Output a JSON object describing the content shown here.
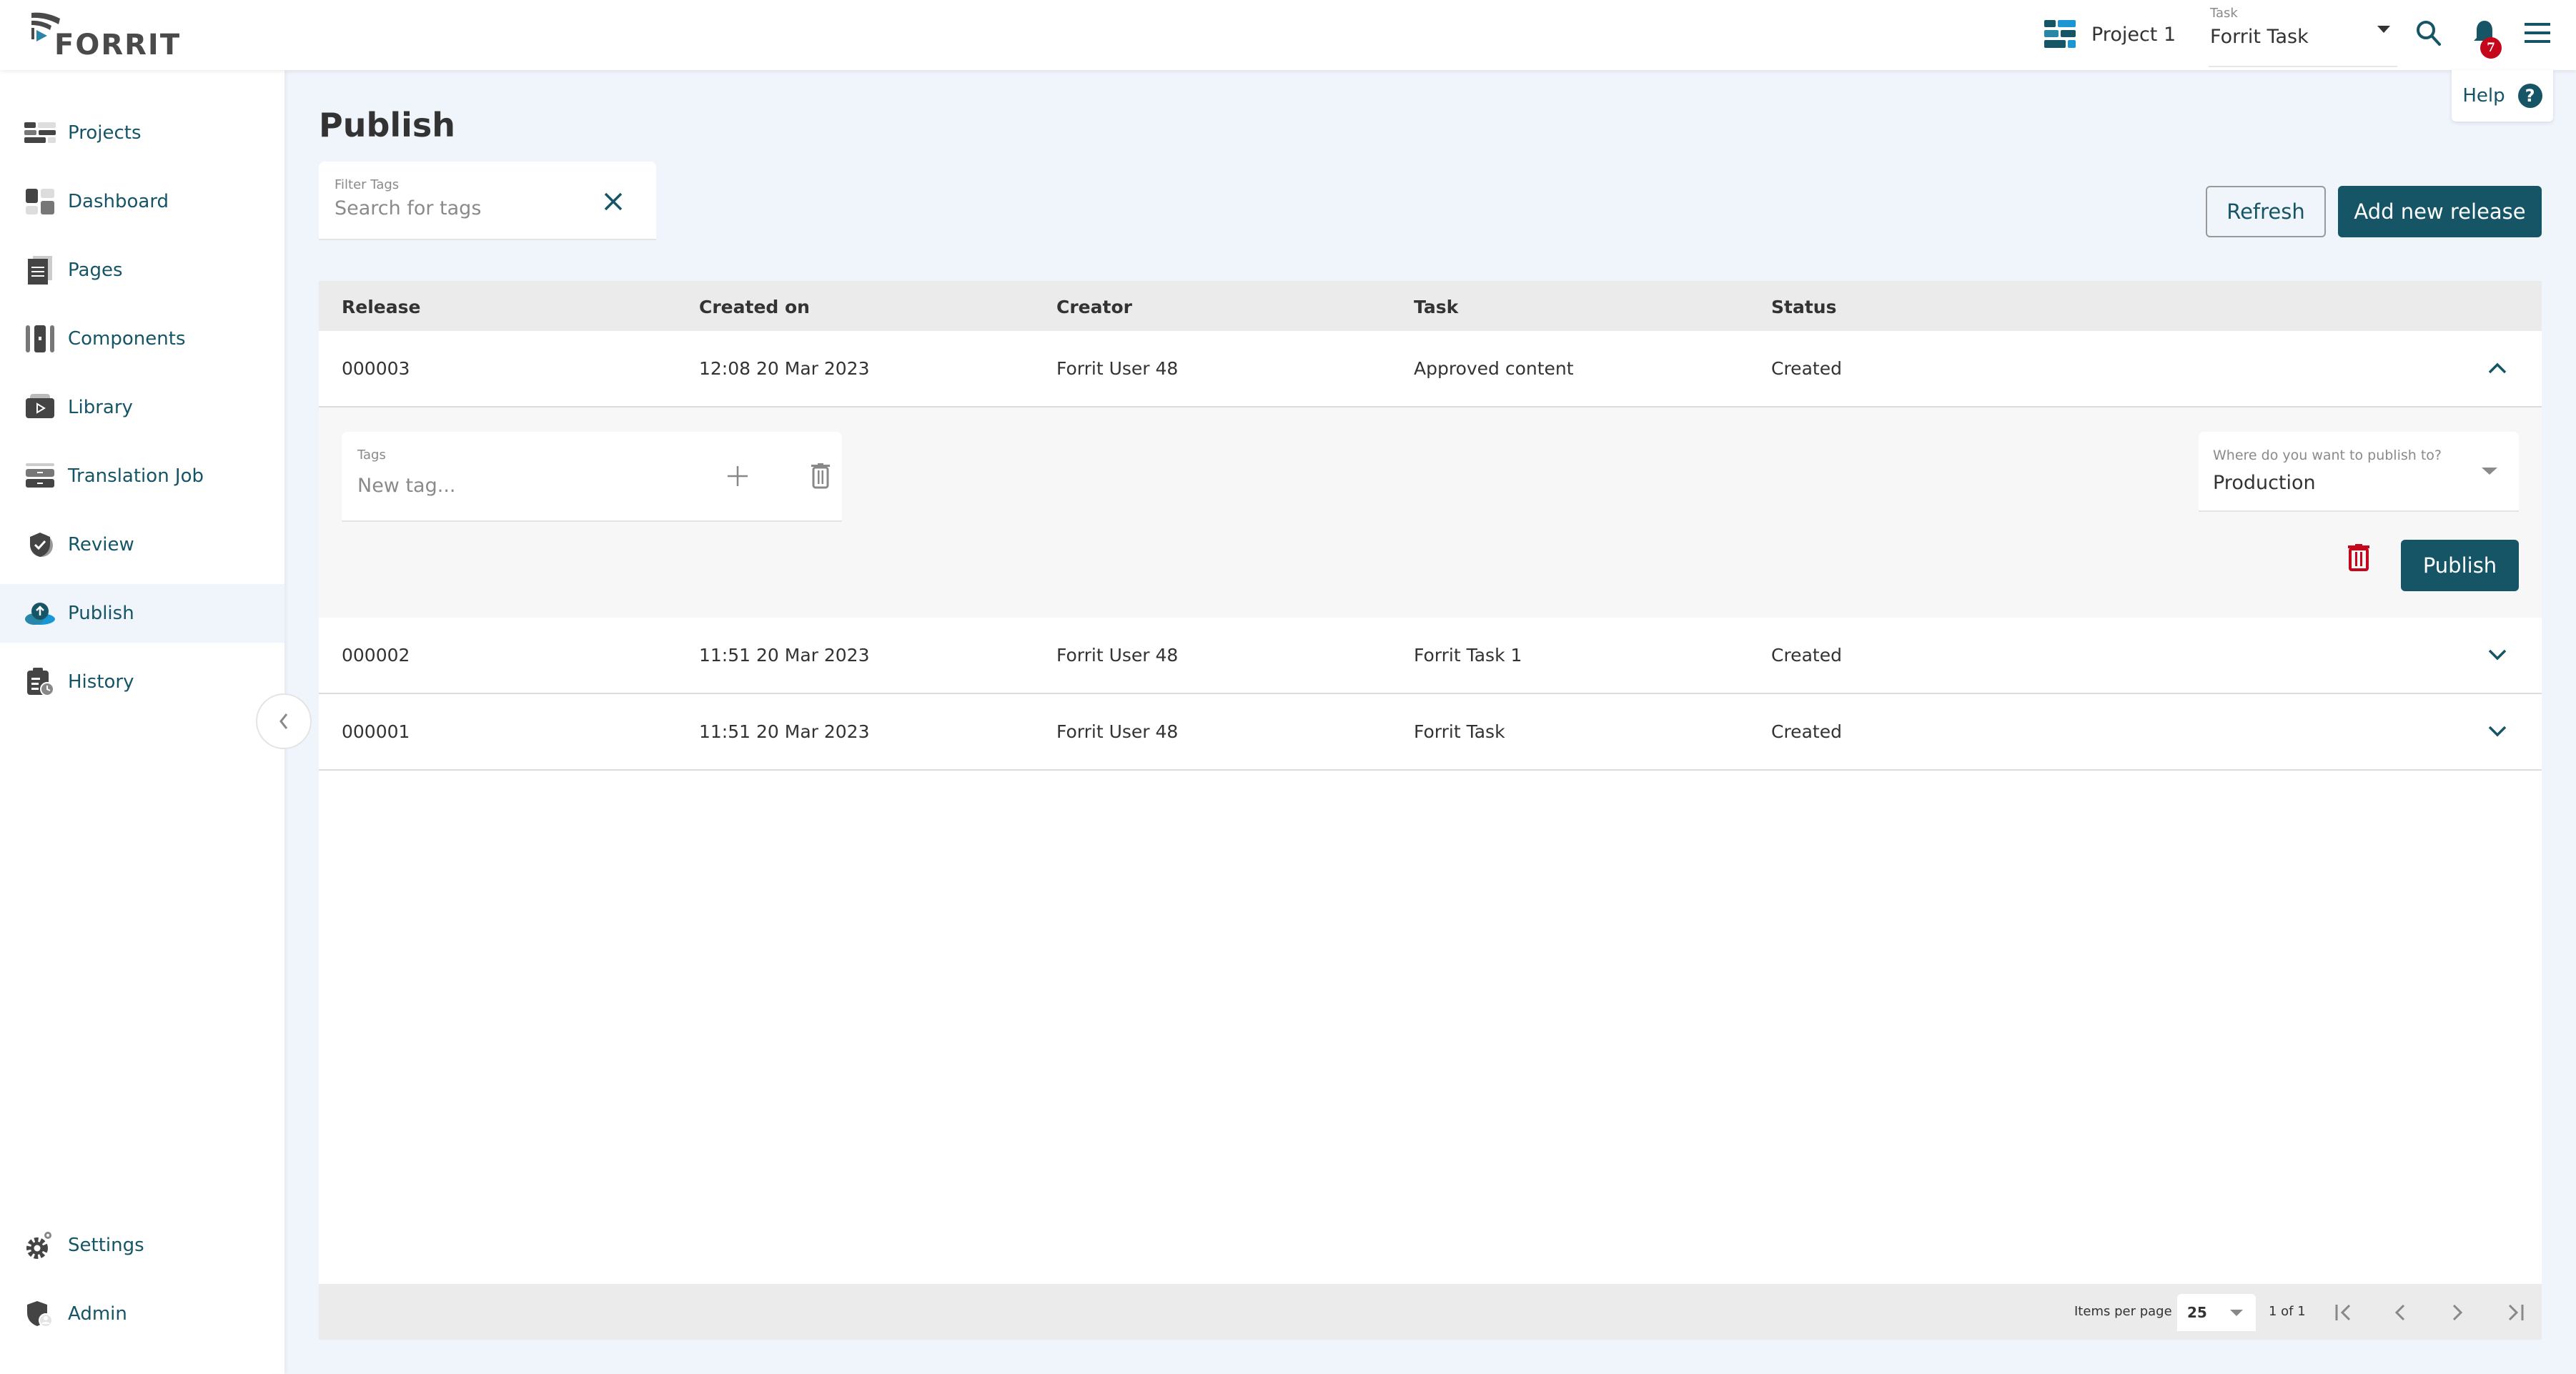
{
  "app": {
    "name": "FORRIT",
    "brand_color": "#155566",
    "accent_color": "#1a96d4",
    "danger_color": "#c4071b"
  },
  "topbar": {
    "project_label": "Project 1",
    "task_caption": "Task",
    "task_value": "Forrit Task",
    "notification_count": "7",
    "help_label": "Help",
    "help_icon_glyph": "?"
  },
  "sidebar": {
    "items": [
      {
        "label": "Projects",
        "icon": "projects-icon"
      },
      {
        "label": "Dashboard",
        "icon": "dashboard-icon"
      },
      {
        "label": "Pages",
        "icon": "pages-icon"
      },
      {
        "label": "Components",
        "icon": "components-icon"
      },
      {
        "label": "Library",
        "icon": "library-icon"
      },
      {
        "label": "Translation Job",
        "icon": "translation-job-icon"
      },
      {
        "label": "Review",
        "icon": "review-icon"
      },
      {
        "label": "Publish",
        "icon": "publish-icon",
        "active": true
      },
      {
        "label": "History",
        "icon": "history-icon"
      }
    ],
    "bottom_items": [
      {
        "label": "Settings",
        "icon": "settings-icon"
      },
      {
        "label": "Admin",
        "icon": "admin-icon"
      }
    ]
  },
  "main": {
    "title": "Publish",
    "filter": {
      "caption": "Filter Tags",
      "placeholder": "Search for tags",
      "value": ""
    },
    "refresh_label": "Refresh",
    "add_release_label": "Add new release"
  },
  "table": {
    "columns": [
      "Release",
      "Created on",
      "Creator",
      "Task",
      "Status"
    ],
    "rows": [
      {
        "release": "000003",
        "created_on": "12:08 20 Mar 2023",
        "creator": "Forrit User 48",
        "task": "Approved content",
        "status": "Created",
        "expanded": true
      },
      {
        "release": "000002",
        "created_on": "11:51 20 Mar 2023",
        "creator": "Forrit User 48",
        "task": "Forrit Task 1",
        "status": "Created",
        "expanded": false
      },
      {
        "release": "000001",
        "created_on": "11:51 20 Mar 2023",
        "creator": "Forrit User 48",
        "task": "Forrit Task",
        "status": "Created",
        "expanded": false
      }
    ],
    "expanded_panel": {
      "tags_caption": "Tags",
      "tags_placeholder": "New tag...",
      "destination_caption": "Where do you want to publish to?",
      "destination_value": "Production",
      "publish_label": "Publish"
    },
    "footer": {
      "items_per_page_label": "Items per page",
      "items_per_page_value": "25",
      "page_info": "1 of 1"
    }
  }
}
